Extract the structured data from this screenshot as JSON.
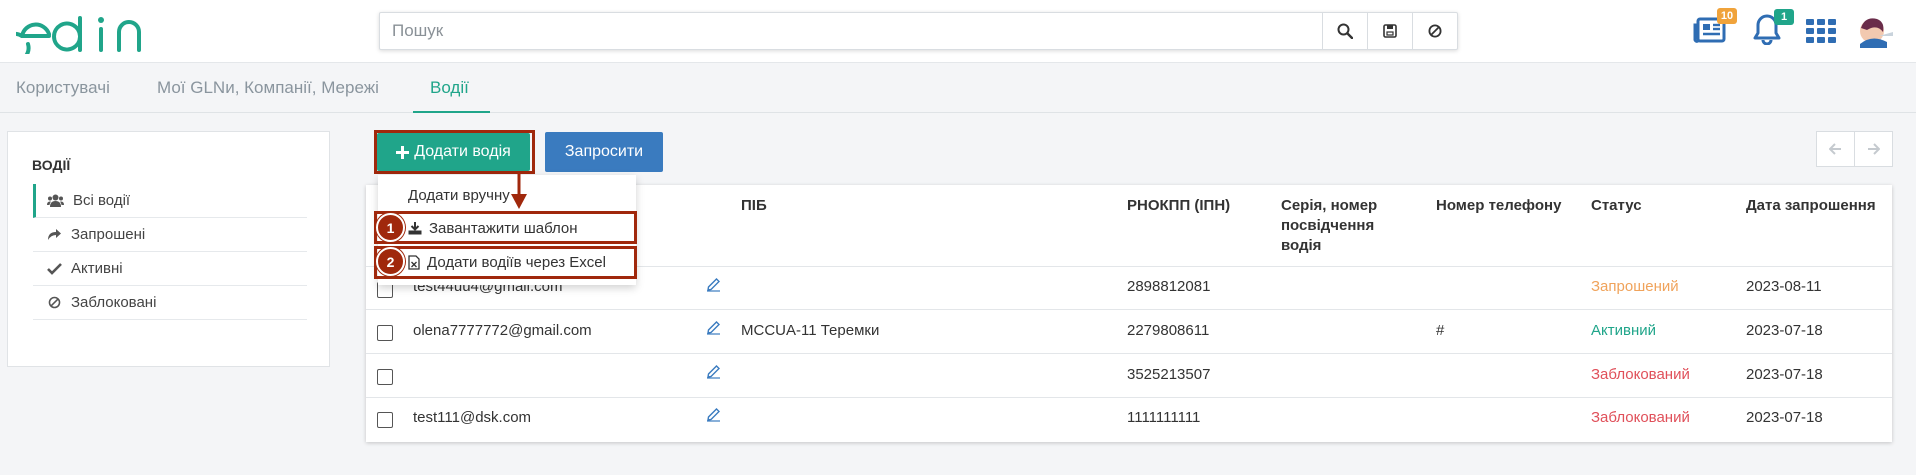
{
  "header": {
    "logo_text": "edin",
    "search": {
      "placeholder": "Пошук",
      "value": ""
    },
    "icons": [
      "search-icon",
      "save-icon",
      "block-icon",
      "news-icon",
      "bell-icon",
      "apps-grid-icon",
      "avatar"
    ],
    "news_badge": "10",
    "bell_badge": "1",
    "accent": "#20a58a",
    "badge_colors": {
      "news": "#f0a33b",
      "bell": "#20a58a"
    }
  },
  "tabs": [
    {
      "label": "Користувачі"
    },
    {
      "label": "Мої GLNи, Компанії, Мережі"
    },
    {
      "label": "Водії",
      "active": true
    }
  ],
  "sidebar": {
    "title": "ВОДІЇ",
    "items": [
      {
        "label": "Всі водії",
        "icon": "users-icon",
        "active": true
      },
      {
        "label": "Запрошені",
        "icon": "share-icon"
      },
      {
        "label": "Активні",
        "icon": "check-icon"
      },
      {
        "label": "Заблоковані",
        "icon": "block-icon"
      }
    ]
  },
  "toolbar": {
    "add_label": "Додати водія",
    "invite_label": "Запросити"
  },
  "dropdown": {
    "items": [
      {
        "label": "Додати вручну"
      },
      {
        "label": "Завантажити шаблон",
        "icon": "download-icon",
        "step": "1"
      },
      {
        "label": "Додати водіїв через Excel",
        "icon": "excel-file-icon",
        "step": "2"
      }
    ]
  },
  "table": {
    "columns": [
      "ПІБ",
      "РНОКПП (ІПН)",
      "Серія, номер посвідчення водія",
      "Номер телефону",
      "Статус",
      "Дата запрошення"
    ],
    "column_lines": {
      "series": [
        "Серія, номер",
        "посвідчення",
        "водія"
      ]
    },
    "rows": [
      {
        "email": "test44uu4@gmail.com",
        "name": "",
        "ipn": "2898812081",
        "license": "",
        "phone": "",
        "status": "Запрошений",
        "status_color": "#f0a35b",
        "date": "2023-08-11"
      },
      {
        "email": "olena7777772@gmail.com",
        "name": "МССUA-11 Теремки",
        "ipn": "2279808611",
        "license": "",
        "phone": "#",
        "status": "Активний",
        "status_color": "#20a58a",
        "date": "2023-07-18"
      },
      {
        "email": "",
        "name": "",
        "ipn": "3525213507",
        "license": "",
        "phone": "",
        "status": "Заблокований",
        "status_color": "#e0505a",
        "date": "2023-07-18"
      },
      {
        "email": "test111@dsk.com",
        "name": "",
        "ipn": "1111111111",
        "license": "",
        "phone": "",
        "status": "Заблокований",
        "status_color": "#e0505a",
        "date": "2023-07-18"
      }
    ]
  }
}
